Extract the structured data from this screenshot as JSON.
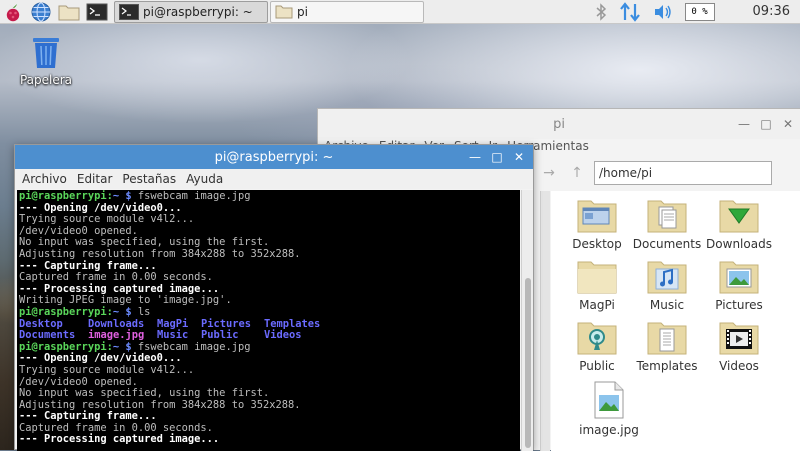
{
  "taskbar": {
    "tasks": [
      {
        "label": "pi@raspberrypi: ~",
        "type": "terminal"
      },
      {
        "label": "pi",
        "type": "folder"
      }
    ],
    "cpu": "0 %",
    "clock": "09:36"
  },
  "desktop": {
    "trash_label": "Papelera"
  },
  "file_manager": {
    "title": "pi",
    "menu": [
      "Archivo",
      "Editar",
      "Ver",
      "Sort",
      "Ir",
      "Herramientas"
    ],
    "path": "/home/pi",
    "items": [
      {
        "label": "Desktop",
        "icon": "desktop-folder"
      },
      {
        "label": "Documents",
        "icon": "documents-folder"
      },
      {
        "label": "Downloads",
        "icon": "downloads-folder"
      },
      {
        "label": "MagPi",
        "icon": "folder"
      },
      {
        "label": "Music",
        "icon": "music-folder"
      },
      {
        "label": "Pictures",
        "icon": "pictures-folder"
      },
      {
        "label": "Public",
        "icon": "public-folder"
      },
      {
        "label": "Templates",
        "icon": "templates-folder"
      },
      {
        "label": "Videos",
        "icon": "videos-folder"
      },
      {
        "label": "image.jpg",
        "icon": "image-file"
      }
    ]
  },
  "terminal": {
    "title": "pi@raspberrypi: ~",
    "menu": [
      "Archivo",
      "Editar",
      "Pestañas",
      "Ayuda"
    ],
    "prompt_user": "pi@raspberrypi",
    "prompt_sep": ":",
    "prompt_path": "~ $",
    "cmd_fswebcam": " fswebcam image.jpg",
    "cmd_ls": " ls",
    "out_opening": "--- Opening /dev/video0...",
    "out_trying": "Trying source module v4l2...",
    "out_opened": "/dev/video0 opened.",
    "out_noinput": "No input was specified, using the first.",
    "out_adjust": "Adjusting resolution from 384x288 to 352x288.",
    "out_capturing": "--- Capturing frame...",
    "out_captured": "Captured frame in 0.00 seconds.",
    "out_processing": "--- Processing captured image...",
    "out_writing": "Writing JPEG image to 'image.jpg'.",
    "ls_row1": [
      "Desktop",
      "Downloads",
      "MagPi",
      "Pictures",
      "Templates"
    ],
    "ls_row2": [
      "Documents",
      "image.jpg",
      "Music",
      "Public",
      "Videos"
    ]
  }
}
